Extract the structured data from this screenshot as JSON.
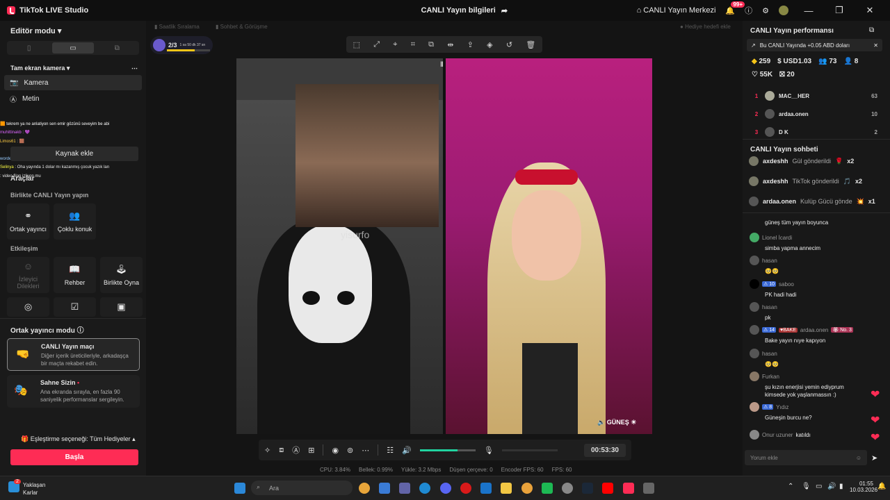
{
  "titlebar": {
    "app_name": "TikTok LIVE Studio",
    "center_title": "CANLI Yayın bilgileri",
    "center_link": "CANLI Yayın Merkezi",
    "notif_badge": "99+"
  },
  "left": {
    "editor_mode": "Editör modu",
    "scene": "Tam ekran kamera",
    "sources": [
      "Kamera",
      "Metin"
    ],
    "add_source": "Kaynak ekle",
    "tools_label": "Araçlar",
    "together_label": "Birlikte CANLI Yayın yapın",
    "tools_top": [
      "Ortak yayıncı",
      "Çoklu konuk"
    ],
    "interaction_label": "Etkileşim",
    "tools_mid": [
      "İzleyici Dilekleri",
      "Rehber",
      "Birlikte Oyna"
    ],
    "cohost_mode_label": "Ortak yayıncı modu",
    "modes": [
      {
        "title": "CANLI Yayın maçı",
        "desc": "Diğer içerik üreticileriyle, arkadaşça bir maçta rekabet edin."
      },
      {
        "title": "Sahne Sizin",
        "desc": "Ana ekranda sırayla, en fazla 90 saniyelik performanslar sergileyin."
      }
    ],
    "match_option": "Eşleştirme seçeneği: Tüm Hediyeler",
    "match_button": "Başla",
    "overlay_chat": [
      {
        "user": "muhittinakb",
        "text": ""
      },
      {
        "user": "Limos61",
        "text": ""
      },
      {
        "user": "wordex57",
        "text": ""
      },
      {
        "user": "Selinya",
        "text": "Oha yayında 1 dolar mı kazanmış çocuk yazık lan"
      },
      {
        "user": "",
        "text": "video filan izliyon mu"
      },
      {
        "user": "",
        "text": "tekrem ya ne anlatiyon sen emir gözünü seveyim be abi"
      }
    ]
  },
  "center": {
    "top_tabs": [
      "Saatlik Sıralama",
      "Sohbet & Görüşme",
      "Hediye hedefi ekle"
    ],
    "match_count": "2/3",
    "match_timer": "1 sa 50 dk 37 sn",
    "right_streamer_name": "GÜNEŞ",
    "overlay_text": "yisurfo",
    "timer": "00:53:30",
    "stats": [
      {
        "label": "CPU:",
        "value": "3.84%"
      },
      {
        "label": "Bellek:",
        "value": "0.99%"
      },
      {
        "label": "Yükle:",
        "value": "3.2 Mbps"
      },
      {
        "label": "Düşen çerçeve:",
        "value": "0"
      },
      {
        "label": "Encoder FPS:",
        "value": "60"
      },
      {
        "label": "FPS:",
        "value": "60"
      }
    ],
    "volume_level": 0.68
  },
  "right": {
    "performance_title": "CANLI Yayın performansı",
    "promo_text": "Bu CANLI Yayında +0.05 ABD doları",
    "metrics": [
      "259",
      "USD1.03",
      "73",
      "8"
    ],
    "metrics2": [
      "55K",
      "20"
    ],
    "ranking": [
      {
        "rank": "1",
        "name": "MAC__HER",
        "score": "63"
      },
      {
        "rank": "2",
        "name": "ardaa.onen",
        "score": "10"
      },
      {
        "rank": "3",
        "name": "D K",
        "score": "2"
      }
    ],
    "chat_title": "CANLI Yayın sohbeti",
    "gifts": [
      {
        "user": "axdeshh",
        "action": "Gül gönderildi",
        "count": "x2"
      },
      {
        "user": "axdeshh",
        "action": "TikTok gönderildi",
        "count": "x2"
      },
      {
        "user": "ardaa.onen",
        "action": "Kulüp Gücü gönde",
        "count": "x1"
      }
    ],
    "chat": [
      {
        "user": "",
        "level": "",
        "text": "güneş tüm yayın boyunca"
      },
      {
        "user": "Lionel İcardi",
        "level": "",
        "text": "simba yapma annecim"
      },
      {
        "user": "hasan",
        "level": "",
        "text": "🥺🥺"
      },
      {
        "user": "saboo",
        "level": "10",
        "text": "PK hadi hadi"
      },
      {
        "user": "hasan",
        "level": "",
        "text": "pk"
      },
      {
        "user": "ardaa.onen",
        "level": "14",
        "text": "Bake yayın nıye kapıyon"
      },
      {
        "user": "hasan",
        "level": "",
        "text": "🥺🥺"
      },
      {
        "user": "Furkan",
        "level": "",
        "text": "şu kızın enerjisi yemin ediyprum kimsede yok yaşlanmassın :)"
      },
      {
        "user": "Yıdız",
        "level": "8",
        "text": "Güneşin burcu ne?"
      },
      {
        "user": "Onur uzuner",
        "level": "",
        "text": "katıldı"
      }
    ],
    "chat_badges": {
      "bake": "BAKE",
      "no3": "No. 3"
    },
    "comment_placeholder": "Yorum ekle"
  },
  "taskbar": {
    "weather_title": "Yaklaşan",
    "weather_sub": "Karlar",
    "weather_badge": "2",
    "search_placeholder": "Ara",
    "time": "01:55",
    "date": "10.03.2026"
  }
}
